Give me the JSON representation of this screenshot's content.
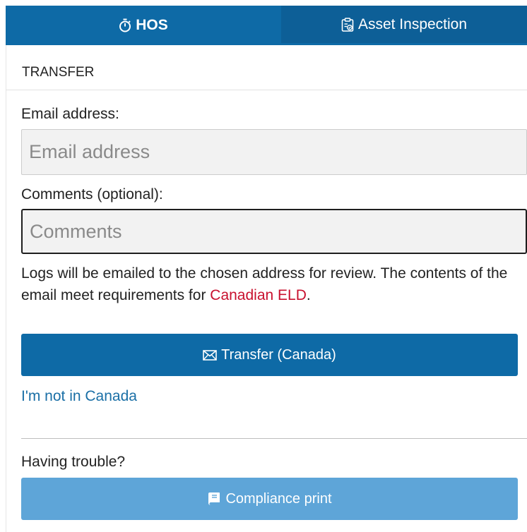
{
  "tabs": {
    "hos_label": "HOS",
    "hos_icon": "stopwatch-icon",
    "asset_label": "Asset Inspection",
    "asset_icon": "clipboard-check-icon"
  },
  "section": {
    "title": "TRANSFER"
  },
  "form": {
    "email_label": "Email address:",
    "email_placeholder": "Email address",
    "email_value": "",
    "comments_label": "Comments (optional):",
    "comments_placeholder": "Comments",
    "comments_value": ""
  },
  "help": {
    "text_before": "Logs will be emailed to the chosen address for review. The contents of the email meet requirements for ",
    "link_text": "Canadian ELD",
    "text_after": "."
  },
  "actions": {
    "transfer_label": "Transfer (Canada)",
    "transfer_icon": "envelope-icon",
    "not_canada_label": "I'm not in Canada",
    "trouble_label": "Having trouble?",
    "compliance_label": "Compliance print",
    "compliance_icon": "book-icon"
  },
  "colors": {
    "primary": "#0e6aa6",
    "secondary": "#5ea5d8",
    "link": "#1a6fa6",
    "accent_red": "#c8102e"
  }
}
